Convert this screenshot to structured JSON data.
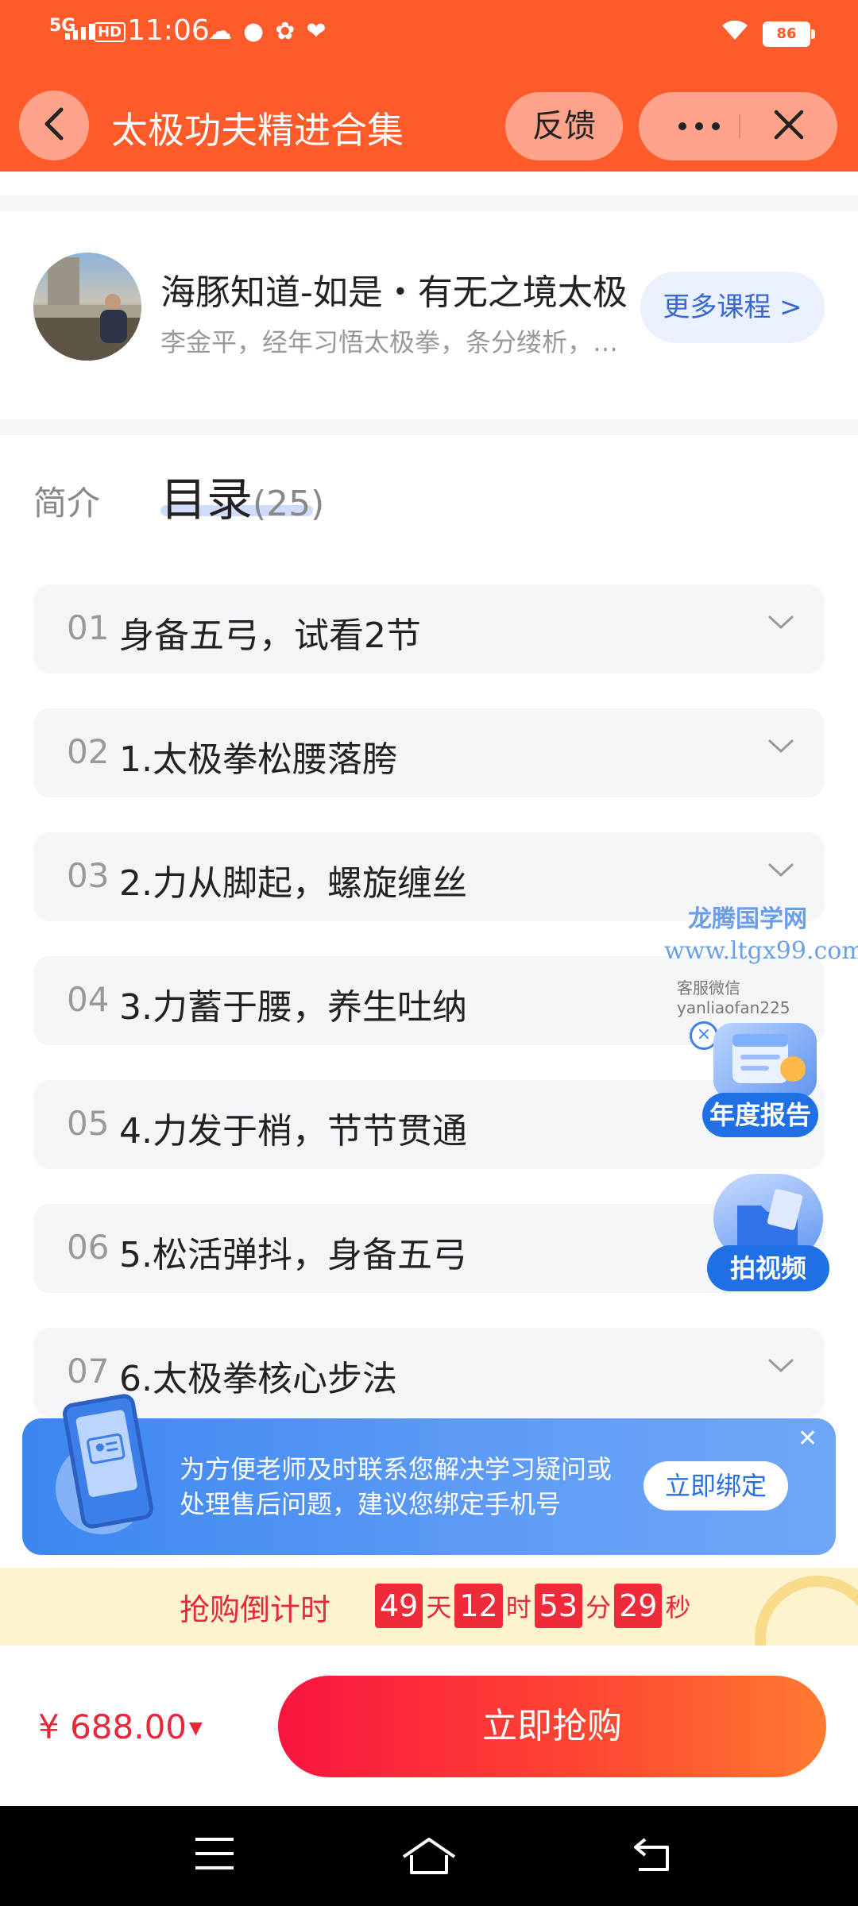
{
  "status_bar": {
    "network": "5G",
    "hd": "HD",
    "time": "11:06",
    "battery": "86",
    "icons": [
      "wechat-moments-icon",
      "message-icon",
      "app-icon-1",
      "app-icon-2",
      "wifi-icon",
      "battery-icon"
    ]
  },
  "header": {
    "title": "太极功夫精进合集",
    "feedback_label": "反馈",
    "icons": [
      "back-icon",
      "more-icon",
      "close-icon"
    ]
  },
  "teacher": {
    "name": "海豚知道-如是・有无之境太极",
    "desc": "李金平，经年习悟太极拳，条分缕析，…",
    "more_label": "更多课程 >"
  },
  "tabs": {
    "intro": "简介",
    "catalog": "目录",
    "catalog_count": "(25)"
  },
  "lessons": [
    {
      "num": "01",
      "title": "身备五弓，试看2节"
    },
    {
      "num": "02",
      "title": "1.太极拳松腰落胯"
    },
    {
      "num": "03",
      "title": "2.力从脚起，螺旋缠丝"
    },
    {
      "num": "04",
      "title": "3.力蓄于腰，养生吐纳"
    },
    {
      "num": "05",
      "title": "4.力发于梢，节节贯通"
    },
    {
      "num": "06",
      "title": "5.松活弹抖，身备五弓"
    },
    {
      "num": "07",
      "title": "6.太极拳核心步法"
    }
  ],
  "watermark": {
    "line1": "龙腾国学网",
    "line2": "www.ltgx99.com",
    "line3": "客服微信 yanliaofan225"
  },
  "floating": {
    "annual_report": "年度报告",
    "shoot_video": "拍视频"
  },
  "bind_banner": {
    "line1": "为方便老师及时联系您解决学习疑问或",
    "line2": "处理售后问题，建议您绑定手机号",
    "button": "立即绑定"
  },
  "countdown": {
    "label": "抢购倒计时",
    "days": "49",
    "days_unit": "天",
    "hours": "12",
    "hours_unit": "时",
    "minutes": "53",
    "minutes_unit": "分",
    "seconds": "29",
    "seconds_unit": "秒"
  },
  "purchase": {
    "price": "¥ 688.00",
    "buy_label": "立即抢购"
  },
  "colors": {
    "header": "#ff5a2a",
    "accent_blue": "#3767d3",
    "price_red": "#e6283a"
  }
}
